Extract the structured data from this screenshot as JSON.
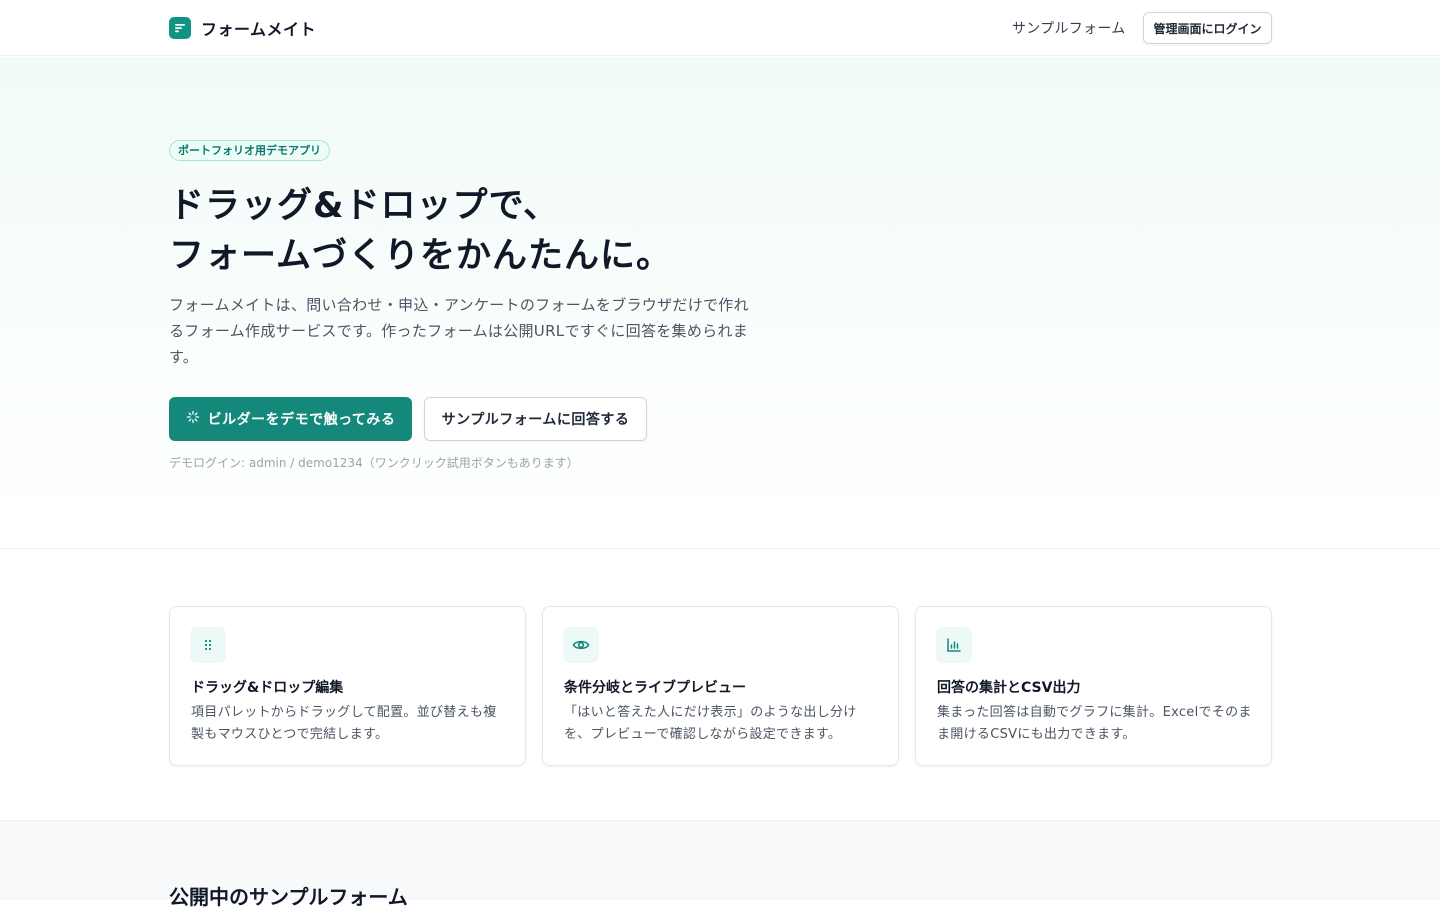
{
  "header": {
    "brand_name": "フォームメイト",
    "nav_sample": "サンプルフォーム",
    "login_label": "管理画面にログイン"
  },
  "hero": {
    "badge": "ポートフォリオ用デモアプリ",
    "title_line1": "ドラッグ&ドロップで、",
    "title_line2": "フォームづくりをかんたんに。",
    "description": "フォームメイトは、問い合わせ・申込・アンケートのフォームをブラウザだけで作れるフォーム作成サービスです。作ったフォームは公開URLですぐに回答を集められます。",
    "primary_button": "ビルダーをデモで触ってみる",
    "secondary_button": "サンプルフォームに回答する",
    "demo_note": "デモログイン: admin / demo1234（ワンクリック試用ボタンもあります）"
  },
  "features": [
    {
      "icon": "drag-handle-icon",
      "title": "ドラッグ&ドロップ編集",
      "description": "項目パレットからドラッグして配置。並び替えも複製もマウスひとつで完結します。"
    },
    {
      "icon": "eye-icon",
      "title": "条件分岐とライブプレビュー",
      "description": "「はいと答えた人にだけ表示」のような出し分けを、プレビューで確認しながら設定できます。"
    },
    {
      "icon": "bar-chart-icon",
      "title": "回答の集計とCSV出力",
      "description": "集まった回答は自動でグラフに集計。Excelでそのまま開けるCSVにも出力できます。"
    }
  ],
  "samples": {
    "title": "公開中のサンプルフォーム"
  },
  "colors": {
    "accent": "#14897b",
    "accent_light": "#edf9f6"
  }
}
